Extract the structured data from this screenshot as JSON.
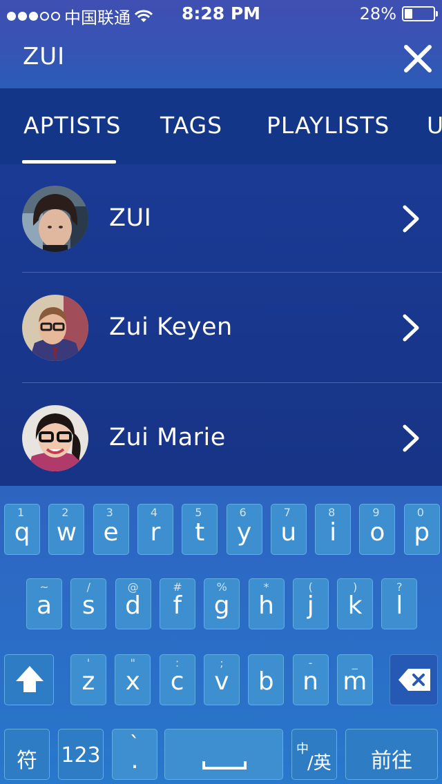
{
  "status_bar": {
    "carrier": "中国联通",
    "time": "8:28 PM",
    "battery": "28%",
    "battery_level": 0.28,
    "signal_bars": 3,
    "signal_total": 5
  },
  "search": {
    "query": "ZUI"
  },
  "tabs": [
    {
      "label": "APTISTS",
      "active": true
    },
    {
      "label": "TAGS",
      "active": false
    },
    {
      "label": "PLAYLISTS",
      "active": false
    },
    {
      "label": "U",
      "active": false
    }
  ],
  "results": [
    {
      "name": "ZUI",
      "avatar": "avatar-photo"
    },
    {
      "name": "Zui Keyen",
      "avatar": "avatar-photo"
    },
    {
      "name": "Zui Marie",
      "avatar": "avatar-photo"
    }
  ],
  "keyboard": {
    "row1": [
      {
        "k": "q",
        "n": "1"
      },
      {
        "k": "w",
        "n": "2"
      },
      {
        "k": "e",
        "n": "3"
      },
      {
        "k": "r",
        "n": "4"
      },
      {
        "k": "t",
        "n": "5"
      },
      {
        "k": "y",
        "n": "6"
      },
      {
        "k": "u",
        "n": "7"
      },
      {
        "k": "i",
        "n": "8"
      },
      {
        "k": "o",
        "n": "9"
      },
      {
        "k": "p",
        "n": "0"
      }
    ],
    "row2": [
      {
        "k": "a",
        "s": "~"
      },
      {
        "k": "s",
        "s": "/"
      },
      {
        "k": "d",
        "s": "@"
      },
      {
        "k": "f",
        "s": "#"
      },
      {
        "k": "g",
        "s": "%"
      },
      {
        "k": "h",
        "s": "*"
      },
      {
        "k": "j",
        "s": "("
      },
      {
        "k": "k",
        "s": ")"
      },
      {
        "k": "l",
        "s": "?"
      }
    ],
    "row3": [
      {
        "k": "z",
        "s": "'"
      },
      {
        "k": "x",
        "s": "\""
      },
      {
        "k": "c",
        "s": ":"
      },
      {
        "k": "v",
        "s": ";"
      },
      {
        "k": "b",
        "s": ""
      },
      {
        "k": "n",
        "s": "-"
      },
      {
        "k": "m",
        "s": "_"
      }
    ],
    "bottom": {
      "symbol": "符",
      "numbers": "123",
      "punct_top": "`",
      "punct_bottom": ".",
      "lang_zh": "中",
      "lang_en": "/英",
      "go": "前往"
    }
  }
}
